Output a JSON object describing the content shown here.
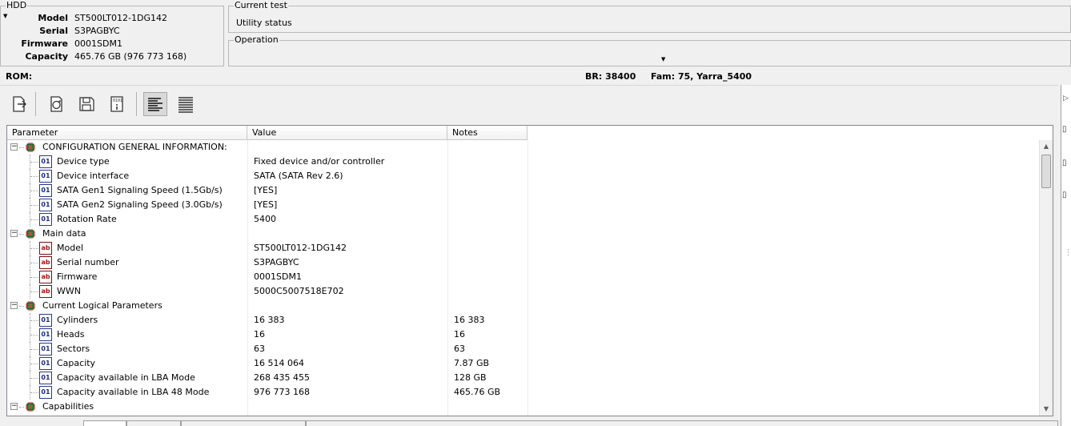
{
  "hdd": {
    "title": "HDD",
    "rows": [
      {
        "key": "Model",
        "value": "ST500LT012-1DG142"
      },
      {
        "key": "Serial",
        "value": "S3PAGBYC"
      },
      {
        "key": "Firmware",
        "value": "0001SDM1"
      },
      {
        "key": "Capacity",
        "value": "465.76 GB (976 773 168)"
      }
    ]
  },
  "current_test": {
    "title": "Current test",
    "status": "Utility status"
  },
  "operation": {
    "title": "Operation",
    "value": ""
  },
  "status_bar": {
    "rom": "ROM:",
    "br": "BR: 38400",
    "fam": "Fam: 75, Yarra_5400"
  },
  "toolbar": {
    "buttons": [
      "export-icon",
      "refresh-icon",
      "save-icon",
      "info-icon",
      "align-left-icon",
      "align-justify-icon"
    ]
  },
  "grid": {
    "headers": {
      "parameter": "Parameter",
      "value": "Value",
      "notes": "Notes"
    },
    "rows": [
      {
        "type": "group",
        "name": "CONFIGURATION GENERAL INFORMATION:",
        "value": "",
        "note": ""
      },
      {
        "type": "num",
        "name": "Device type",
        "value": "Fixed device and/or controller",
        "note": ""
      },
      {
        "type": "num",
        "name": "Device interface",
        "value": "SATA (SATA Rev 2.6)",
        "note": ""
      },
      {
        "type": "num",
        "name": "SATA Gen1 Signaling Speed (1.5Gb/s)",
        "value": "[YES]",
        "note": ""
      },
      {
        "type": "num",
        "name": "SATA Gen2 Signaling Speed (3.0Gb/s)",
        "value": "[YES]",
        "note": ""
      },
      {
        "type": "num",
        "name": "Rotation Rate",
        "value": "5400",
        "note": ""
      },
      {
        "type": "group",
        "name": "Main data",
        "value": "",
        "note": ""
      },
      {
        "type": "ab",
        "name": "Model",
        "value": "ST500LT012-1DG142",
        "note": ""
      },
      {
        "type": "ab",
        "name": "Serial number",
        "value": "S3PAGBYC",
        "note": ""
      },
      {
        "type": "ab",
        "name": "Firmware",
        "value": "0001SDM1",
        "note": ""
      },
      {
        "type": "ab",
        "name": "WWN",
        "value": "5000C5007518E702",
        "note": ""
      },
      {
        "type": "group",
        "name": "Current Logical Parameters",
        "value": "",
        "note": ""
      },
      {
        "type": "num",
        "name": "Cylinders",
        "value": "16 383",
        "note": "16 383"
      },
      {
        "type": "num",
        "name": "Heads",
        "value": "16",
        "note": "16"
      },
      {
        "type": "num",
        "name": "Sectors",
        "value": "63",
        "note": "63"
      },
      {
        "type": "num",
        "name": "Capacity",
        "value": "16 514 064",
        "note": "7.87 GB"
      },
      {
        "type": "num",
        "name": "Capacity available in LBA Mode",
        "value": "268 435 455",
        "note": "128 GB"
      },
      {
        "type": "num",
        "name": "Capacity available in LBA 48 Mode",
        "value": "976 773 168",
        "note": "465.76 GB"
      },
      {
        "type": "group",
        "name": "Capabilities",
        "value": "",
        "note": ""
      }
    ]
  },
  "colors": {
    "accent_blue": "#1a2a8a",
    "ab_red": "#b01010",
    "window_bg": "#f0f0f0"
  }
}
